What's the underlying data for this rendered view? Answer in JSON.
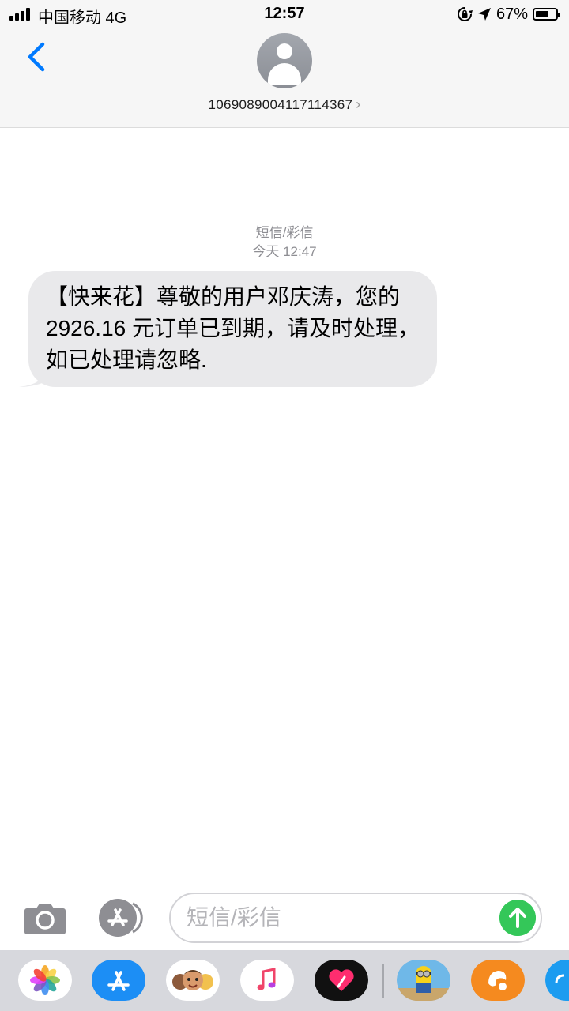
{
  "status_bar": {
    "carrier": "中国移动 4G",
    "time": "12:57",
    "battery_percent": "67%",
    "battery_level": 0.67,
    "signal_bars": 4
  },
  "header": {
    "contact_number": "1069089004117114367",
    "chevron": "›"
  },
  "conversation": {
    "service_label": "短信/彩信",
    "timestamp": "今天 12:47",
    "message": "【快来花】尊敬的用户邓庆涛，您的 2926.16 元订单已到期，请及时处理，如已处理请忽略."
  },
  "composer": {
    "placeholder": "短信/彩信",
    "value": ""
  },
  "app_drawer": {
    "icons": [
      "photos-icon",
      "app-store-icon",
      "memoji-icon",
      "music-icon",
      "digital-touch-icon",
      "minion-game-icon",
      "uc-browser-icon",
      "partial-app-icon"
    ]
  },
  "colors": {
    "accent": "#007aff",
    "bubble_bg": "#e9e9eb",
    "send_green": "#34c759",
    "meta_gray": "#8e8e93"
  }
}
